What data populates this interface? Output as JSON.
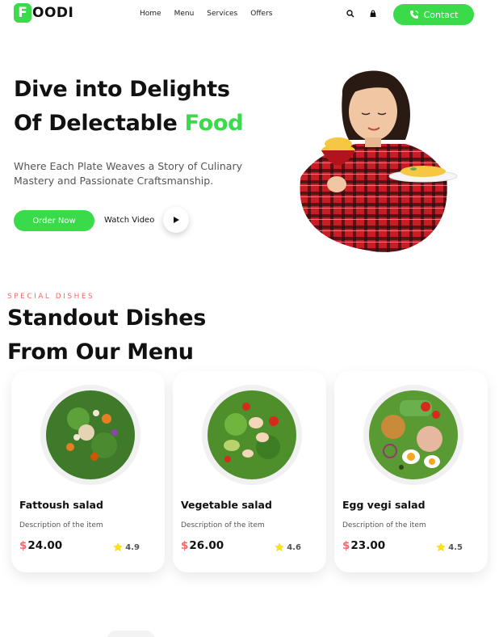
{
  "brand": {
    "letter": "F",
    "rest": "OODI",
    "accent": "#39db4a"
  },
  "nav": {
    "links": [
      "Home",
      "Menu",
      "Services",
      "Offers"
    ],
    "icons": [
      "search-icon",
      "shopping-bag-icon"
    ],
    "contact_label": "Contact"
  },
  "hero": {
    "title_line1": "Dive into Delights",
    "title_line2_prefix": "Of Delectable ",
    "title_line2_accent": "Food",
    "subtitle": "Where Each Plate Weaves a Story of Culinary Mastery and Passionate Craftsmanship.",
    "order_label": "Order Now",
    "watch_label": "Watch Video"
  },
  "section": {
    "eyebrow": "SPECIAL DISHES",
    "title_line1": "Standout Dishes",
    "title_line2": "From Our Menu"
  },
  "dishes": [
    {
      "name": "Fattoush salad",
      "description": "Description of the item",
      "currency": "$",
      "price": "24.00",
      "rating": "4.9"
    },
    {
      "name": "Vegetable salad",
      "description": "Description of the item",
      "currency": "$",
      "price": "26.00",
      "rating": "4.6"
    },
    {
      "name": "Egg vegi salad",
      "description": "Description of the item",
      "currency": "$",
      "price": "23.00",
      "rating": "4.5"
    }
  ],
  "colors": {
    "primary": "#39db4a",
    "price_accent": "#ff6868",
    "star": "#ffe605"
  }
}
